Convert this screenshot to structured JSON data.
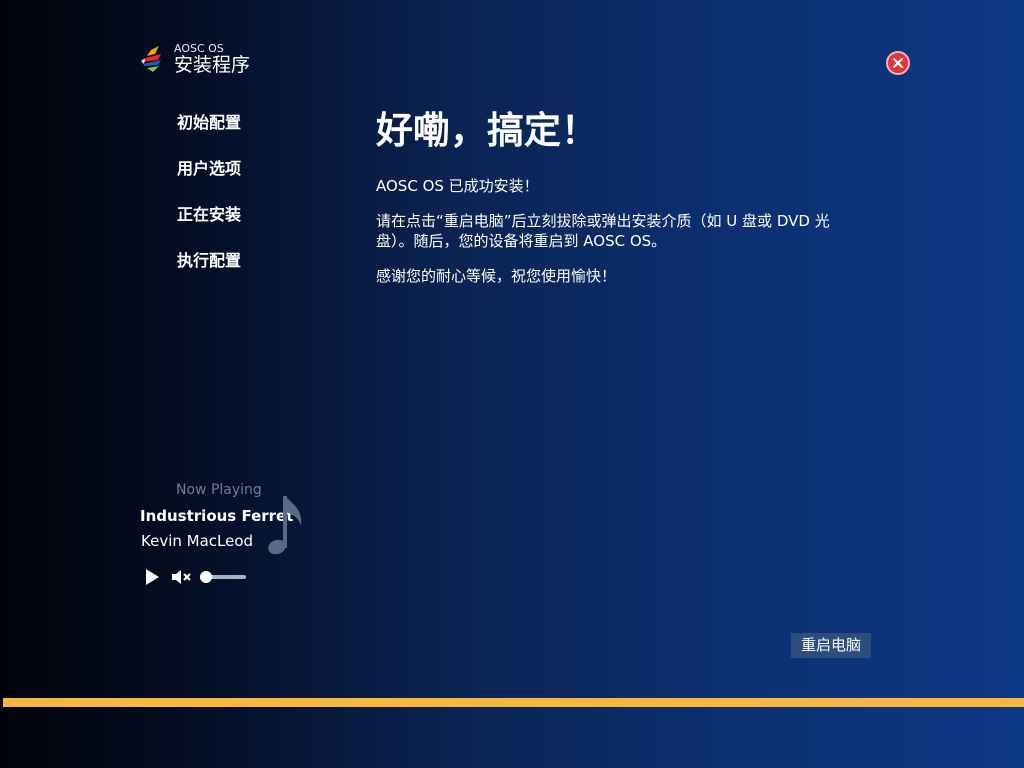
{
  "brand": {
    "small": "AOSC OS",
    "title": "安装程序"
  },
  "nav": {
    "items": [
      "初始配置",
      "用户选项",
      "正在安装",
      "执行配置"
    ]
  },
  "content": {
    "heading": "好嘞，搞定！",
    "para1": "AOSC OS 已成功安装！",
    "para2": "请在点击“重启电脑”后立刻拔除或弹出安装介质（如 U 盘或 DVD 光盘）。随后，您的设备将重启到 AOSC OS。",
    "para3": "感谢您的耐心等候，祝您使用愉快！"
  },
  "player": {
    "now_playing": "Now Playing",
    "track": "Industrious Ferret",
    "artist": "Kevin MacLeod",
    "volume": 0,
    "icons": {
      "play": "play-icon",
      "mute": "volume-muted-icon",
      "note": "music-note-icon"
    }
  },
  "actions": {
    "reboot": "重启电脑"
  },
  "progress": {
    "value": 1.0
  },
  "colors": {
    "accent": "#f9b73e",
    "close": "#e0353d",
    "button": "#2d4d7c"
  }
}
